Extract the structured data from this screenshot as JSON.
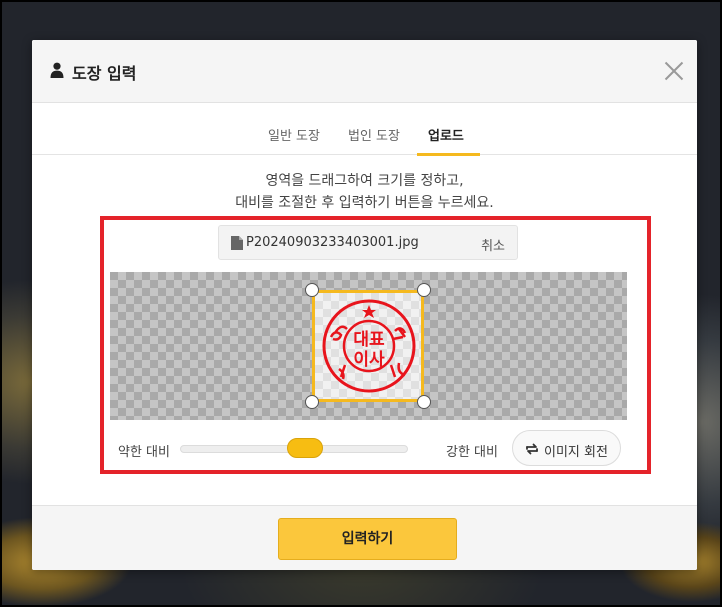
{
  "modal": {
    "title": "도장 입력"
  },
  "tabs": [
    {
      "label": "일반 도장",
      "active": false
    },
    {
      "label": "법인 도장",
      "active": false
    },
    {
      "label": "업로드",
      "active": true
    }
  ],
  "instructions": {
    "line1": "영역을 드래그하여 크기를 정하고,",
    "line2": "대비를 조절한 후 입력하기 버튼을 누르세요."
  },
  "file": {
    "name": "P20240903233403001.jpg",
    "cancel_label": "취소"
  },
  "stamp_image": {
    "text_top": "대표",
    "text_bottom": "이사"
  },
  "contrast": {
    "low_label": "약한 대비",
    "high_label": "강한 대비",
    "level": 0.55
  },
  "rotate": {
    "label": "이미지 회전"
  },
  "footer": {
    "submit_label": "입력하기"
  },
  "colors": {
    "accent": "#f5b91e",
    "button": "#fbc73c",
    "highlight": "#e4232a",
    "stamp": "#e8141c"
  },
  "icons": {
    "header": "user-icon",
    "close": "close-icon",
    "file": "file-icon",
    "rotate": "rotate-icon"
  }
}
